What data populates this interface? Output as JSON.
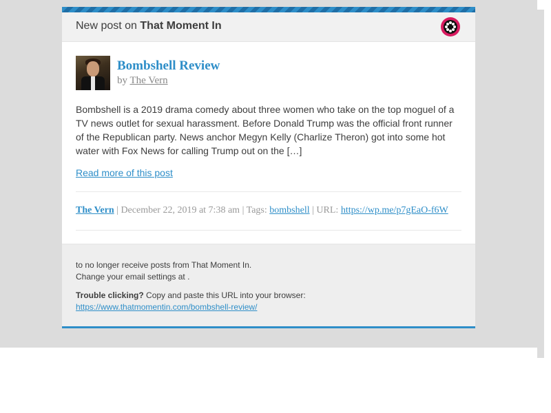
{
  "header": {
    "prefix": "New post on",
    "site_name": "That Moment In",
    "logo_icon": "film-reel-icon"
  },
  "post": {
    "title": "Bombshell Review",
    "by_label": "by",
    "author": "The Vern",
    "excerpt": "Bombshell is a 2019 drama comedy about three women who take on the top moguel of a TV news outlet for sexual harassment. Before Donald Trump was the official front runner of the Republican party. News anchor Megyn Kelly (Charlize Theron) got into some hot water with Fox News for calling Trump out on the […]",
    "read_more": "Read more of this post"
  },
  "meta": {
    "author": "The Vern",
    "sep1": " | ",
    "date": "December 22, 2019 at 7:38 am",
    "sep2": " | ",
    "tags_label": "Tags: ",
    "tag": "bombshell",
    "sep3": " | ",
    "url_label": "URL: ",
    "short_url": "https://wp.me/p7gEaO-f6W"
  },
  "footer": {
    "unsubscribe_text": "to no longer receive posts from That Moment In.",
    "settings_text": "Change your email settings at .",
    "trouble_label": "Trouble clicking?",
    "trouble_text": " Copy and paste this URL into your browser:",
    "full_url": "https://www.thatmomentin.com/bombshell-review/"
  },
  "colors": {
    "accent": "#2e8ec8",
    "logo_bg": "#d81b60",
    "page_bg": "#dcdcdc"
  }
}
